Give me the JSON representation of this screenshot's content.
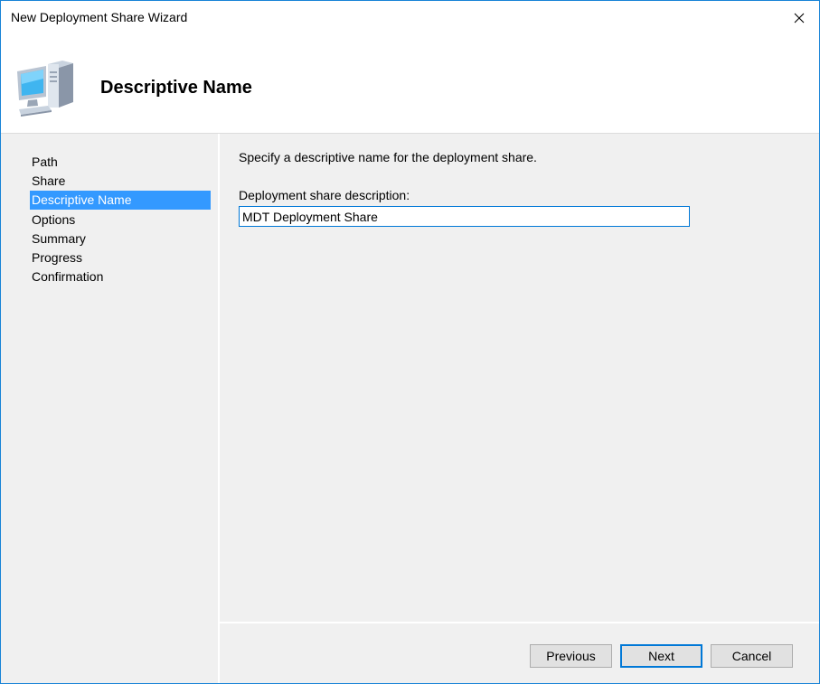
{
  "window": {
    "title": "New Deployment Share Wizard"
  },
  "header": {
    "title": "Descriptive Name",
    "icon": "computer-icon"
  },
  "sidebar": {
    "items": [
      {
        "label": "Path",
        "active": false
      },
      {
        "label": "Share",
        "active": false
      },
      {
        "label": "Descriptive Name",
        "active": true
      },
      {
        "label": "Options",
        "active": false
      },
      {
        "label": "Summary",
        "active": false
      },
      {
        "label": "Progress",
        "active": false
      },
      {
        "label": "Confirmation",
        "active": false
      }
    ]
  },
  "main": {
    "instruction": "Specify a descriptive name for the deployment share.",
    "field_label": "Deployment share description:",
    "field_value": "MDT Deployment Share"
  },
  "buttons": {
    "previous": "Previous",
    "next": "Next",
    "cancel": "Cancel"
  },
  "colors": {
    "accent": "#0078d7",
    "selection": "#3399ff",
    "panel": "#f0f0f0"
  }
}
